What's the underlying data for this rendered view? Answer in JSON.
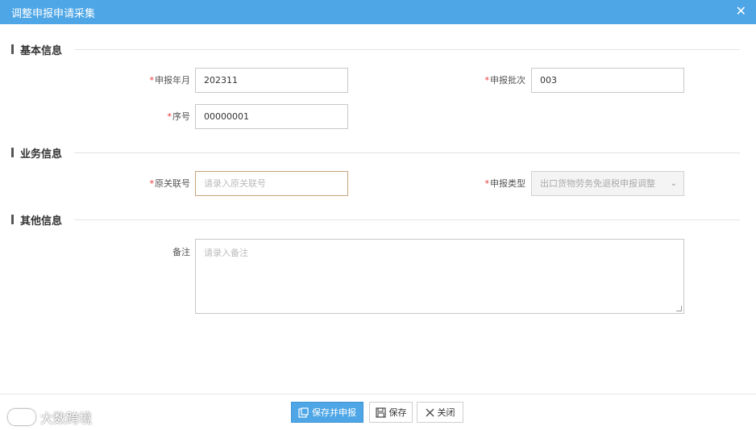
{
  "dialog": {
    "title": "调整申报申请采集",
    "close_glyph": "✕"
  },
  "sections": {
    "basic": "基本信息",
    "business": "业务信息",
    "other": "其他信息"
  },
  "fields": {
    "period": {
      "label": "申报年月",
      "value": "202311",
      "required": true
    },
    "batch": {
      "label": "申报批次",
      "value": "003",
      "required": true
    },
    "seq": {
      "label": "序号",
      "value": "00000001",
      "required": true
    },
    "original_ref": {
      "label": "原关联号",
      "placeholder": "请录入原关联号",
      "required": true
    },
    "declare_type": {
      "label": "申报类型",
      "value": "出口货物劳务免退税申报调整",
      "required": true
    },
    "remark": {
      "label": "备注",
      "placeholder": "请录入备注"
    }
  },
  "buttons": {
    "save_declare": "保存并申报",
    "save": "保存",
    "close": "关闭"
  },
  "watermark": {
    "text": "大数跨境"
  },
  "required_mark": "*",
  "colors": {
    "header": "#4ea6e6",
    "primary_button": "#4ea6e6",
    "focus_border": "#c9a27c"
  }
}
